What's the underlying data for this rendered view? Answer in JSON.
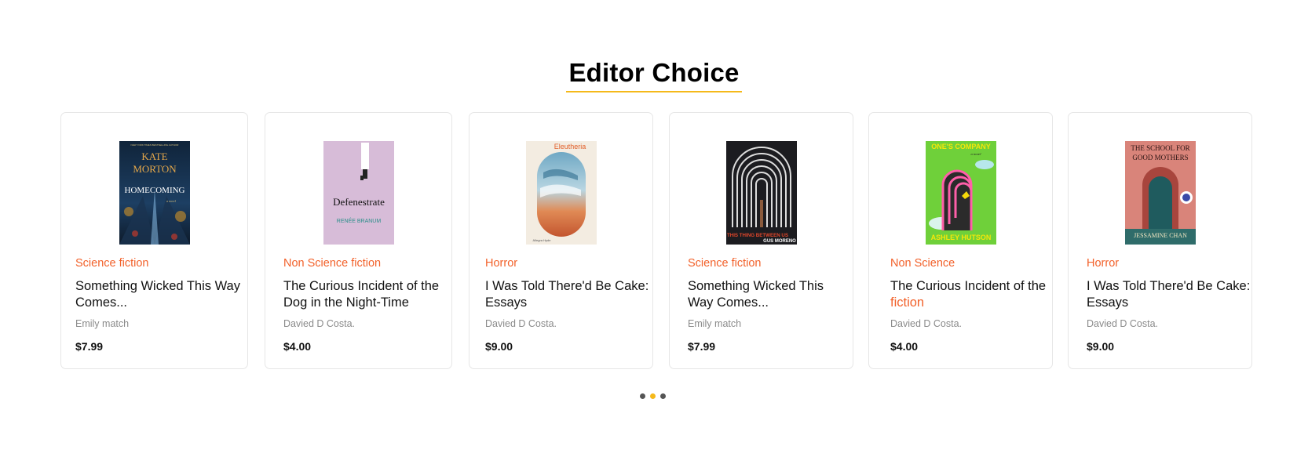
{
  "section": {
    "title": "Editor Choice"
  },
  "colors": {
    "accent": "#f5b91a",
    "category": "#f2612a"
  },
  "books": [
    {
      "category": "Science fiction",
      "title_line1": "Something Wicked This Way",
      "title_line2": "Comes...",
      "author": "Emily match",
      "price": "$7.99",
      "cover": {
        "author_top": "NEW YORK TIMES BESTSELLING AUTHOR",
        "author_name1": "KATE",
        "author_name2": "MORTON",
        "title": "HOMECOMING",
        "sub": "a novel"
      }
    },
    {
      "category": "Non Science fiction",
      "title_line1": "The Curious Incident of the",
      "title_line2": "Dog in the Night-Time",
      "author": "Davied D Costa.",
      "price": "$4.00",
      "cover": {
        "title": "Defenestrate",
        "author_name": "RENÉE BRANUM"
      }
    },
    {
      "category": "Horror",
      "title_line1": "I Was Told There'd Be Cake:",
      "title_line2": "Essays",
      "author": "Davied D Costa.",
      "price": "$9.00",
      "cover": {
        "title": "Eleutheria",
        "author_name": "Allegra Hyde"
      }
    },
    {
      "category": "Science fiction",
      "title_line1": "Something Wicked This",
      "title_line2": "Way Comes...",
      "author": "Emily match",
      "price": "$7.99",
      "cover": {
        "title": "THIS THING BETWEEN US",
        "author_name": "GUS MORENO"
      }
    },
    {
      "category": "Non Science",
      "title_line1": "The Curious Incident of the",
      "title_line2": "fiction",
      "author": "Davied D Costa.",
      "price": "$4.00",
      "cover": {
        "title": "ONE'S COMPANY",
        "sub": "a novel",
        "author_name": "ASHLEY HUTSON"
      }
    },
    {
      "category": "Horror",
      "title_line1": "I Was Told There'd Be Cake:",
      "title_line2": "Essays",
      "author": "Davied D Costa.",
      "price": "$9.00",
      "cover": {
        "title_line1": "THE SCHOOL FOR",
        "title_line2": "GOOD MOTHERS",
        "author_name": "JESSAMINE CHAN"
      }
    }
  ],
  "pagination": {
    "count": 3,
    "active_index": 1
  }
}
